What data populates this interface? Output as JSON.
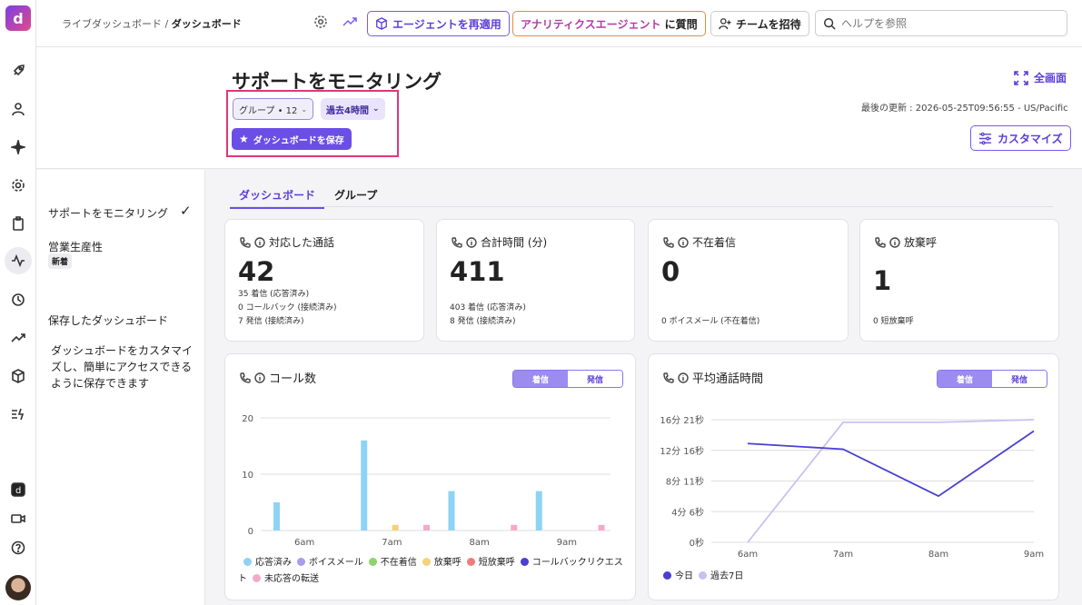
{
  "app": {
    "logo": "d"
  },
  "topbar": {
    "breadcrumb_parent": "ライブダッシュボード",
    "breadcrumb_sep": " / ",
    "breadcrumb_current": "ダッシュボード",
    "reapply_agent": "エージェントを再適用",
    "ask_agent_name": "アナリティクスエージェント",
    "ask_suffix": "に質問",
    "invite_team": "チームを招待",
    "search_placeholder": "ヘルプを参照"
  },
  "header": {
    "title": "サポートをモニタリング",
    "group_chip": "グループ • 12",
    "range_chip": "過去4時間",
    "save_dashboard": "ダッシュボードを保存",
    "fullscreen": "全画面",
    "last_updated": "最後の更新 : 2026-05-25T09:56:55 - US/Pacific",
    "customize": "カスタマイズ"
  },
  "sidenav": {
    "item1": "サポートをモニタリング",
    "item2": "営業生産性",
    "item2_badge": "新着",
    "saved_title": "保存したダッシュボード",
    "saved_desc": "ダッシュボードをカスタマイズし、簡単にアクセスできるように保存できます"
  },
  "tabs": {
    "dashboard": "ダッシュボード",
    "group": "グループ"
  },
  "cards": {
    "handled": {
      "title": "対応した通話",
      "value": "42",
      "lines": [
        "35 着信 (応答済み)",
        "0 コールバック (接続済み)",
        "7 発信 (接続済み)"
      ]
    },
    "total_time": {
      "title": "合計時間 (分)",
      "value": "411",
      "lines": [
        "403 着信 (応答済み)",
        "8 発信 (接続済み)"
      ]
    },
    "missed": {
      "title": "不在着信",
      "value": "0",
      "lines": [
        "0 ボイスメール (不在着信)"
      ]
    },
    "abandoned": {
      "title": "放棄呼",
      "value": "1",
      "lines": [
        "0 短放棄呼"
      ]
    }
  },
  "toggle": {
    "inbound": "着信",
    "outbound": "発信"
  },
  "call_count_chart": {
    "title": "コール数"
  },
  "avg_time_chart": {
    "title": "平均通話時間"
  },
  "chart_data": [
    {
      "type": "bar",
      "title": "コール数",
      "categories": [
        "6am",
        "7am",
        "8am",
        "9am"
      ],
      "yticks": [
        "0",
        "10",
        "20"
      ],
      "ylim": [
        0,
        20
      ],
      "grid": true,
      "legend_position": "bottom",
      "series": [
        {
          "name": "応答済み",
          "color": "#8fd3f4",
          "values": [
            5,
            16,
            7,
            7
          ]
        },
        {
          "name": "ボイスメール",
          "color": "#a99bf0",
          "values": [
            0,
            0,
            0,
            0
          ]
        },
        {
          "name": "不在着信",
          "color": "#8ed36b",
          "values": [
            0,
            0,
            0,
            0
          ]
        },
        {
          "name": "放棄呼",
          "color": "#f5d27a",
          "values": [
            0,
            1,
            0,
            0
          ]
        },
        {
          "name": "短放棄呼",
          "color": "#f27a7a",
          "values": [
            0,
            0,
            0,
            0
          ]
        },
        {
          "name": "コールバックリクエスト",
          "color": "#4a3fd0",
          "values": [
            0,
            0,
            0,
            0
          ]
        },
        {
          "name": "未応答の転送",
          "color": "#f5a9c8",
          "values": [
            0,
            1,
            1,
            1
          ]
        }
      ]
    },
    {
      "type": "line",
      "title": "平均通話時間",
      "categories": [
        "6am",
        "7am",
        "8am",
        "9am"
      ],
      "yticks": [
        "0秒",
        "4分 6秒",
        "8分 11秒",
        "12分 16秒",
        "16分 21秒"
      ],
      "ylim_seconds": [
        0,
        981
      ],
      "grid": true,
      "legend_position": "bottom",
      "series": [
        {
          "name": "今日",
          "color": "#4a3fd0",
          "values_seconds": [
            790,
            745,
            370,
            890
          ]
        },
        {
          "name": "過去7日",
          "color": "#c9c0f2",
          "values_seconds": [
            0,
            960,
            960,
            981
          ]
        }
      ]
    }
  ]
}
